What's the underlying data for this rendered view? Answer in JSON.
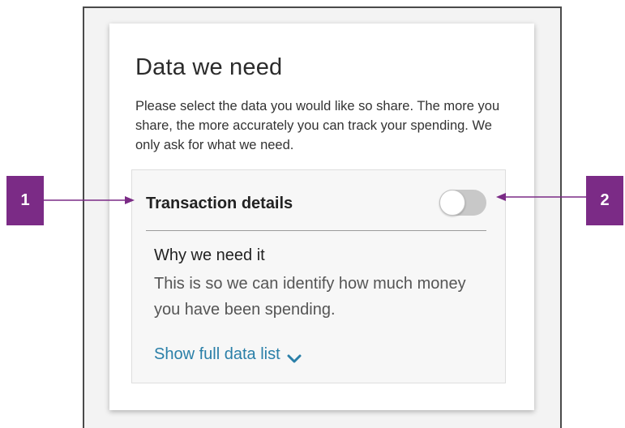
{
  "card": {
    "title": "Data we need",
    "description": "Please select the data you would like so share. The more you share, the more accurately you can track your spending. We only ask for what we need."
  },
  "data_item": {
    "title": "Transaction details",
    "toggle_on": false,
    "why_heading": "Why we need it",
    "why_body": "This is so we can identify how much money you have been spending.",
    "show_more_label": "Show full data list"
  },
  "annotations": [
    {
      "label": "1"
    },
    {
      "label": "2"
    }
  ],
  "colors": {
    "annotation_badge": "#7b2b86",
    "link": "#2a7fa8",
    "toggle_off": "#c8c8c8"
  },
  "icons": {
    "show_more": "chevron-down-icon"
  }
}
